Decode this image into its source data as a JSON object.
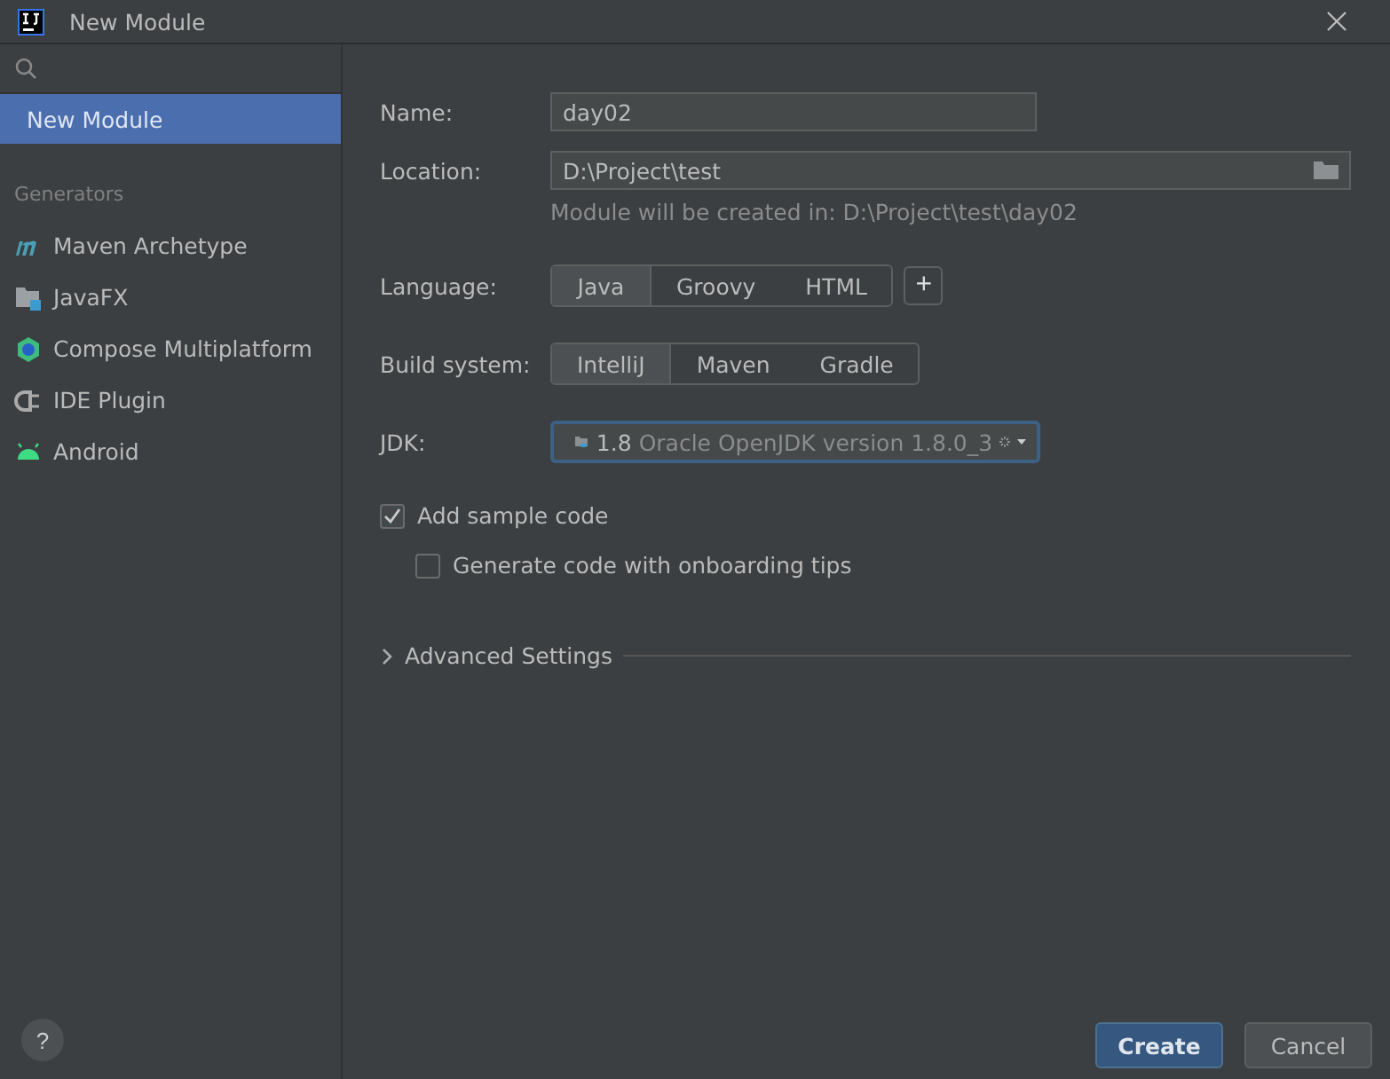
{
  "window": {
    "title": "New Module"
  },
  "help": "?",
  "sidebar": {
    "items": [
      {
        "label": "New Module",
        "selected": true
      }
    ],
    "section": "Generators",
    "generators": [
      {
        "label": "Maven Archetype",
        "kind": "maven",
        "selected": false
      },
      {
        "label": "JavaFX",
        "kind": "javafx",
        "selected": false
      },
      {
        "label": "Compose Multiplatform",
        "kind": "compose",
        "selected": false
      },
      {
        "label": "IDE Plugin",
        "kind": "plugin",
        "selected": false
      },
      {
        "label": "Android",
        "kind": "android",
        "selected": false
      }
    ]
  },
  "form": {
    "name": {
      "label": "Name:",
      "value": "day02"
    },
    "location": {
      "label": "Location:",
      "value": "D:\\Project\\test",
      "hint": "Module will be created in: D:\\Project\\test\\day02"
    },
    "language": {
      "label": "Language:",
      "options": [
        {
          "label": "Java",
          "selected": true
        },
        {
          "label": "Groovy",
          "selected": false
        },
        {
          "label": "HTML",
          "selected": false
        }
      ],
      "add": "+"
    },
    "build_system": {
      "label": "Build system:",
      "options": [
        {
          "label": "IntelliJ",
          "selected": true
        },
        {
          "label": "Maven",
          "selected": false
        },
        {
          "label": "Gradle",
          "selected": false
        }
      ]
    },
    "jdk": {
      "label": "JDK:",
      "version": "1.8",
      "detail": "Oracle OpenJDK version 1.8.0_3"
    },
    "checkboxes": [
      {
        "label": "Add sample code",
        "checked": true,
        "nested": false
      },
      {
        "label": "Generate code with onboarding tips",
        "checked": false,
        "nested": true
      }
    ],
    "advanced": {
      "label": "Advanced Settings",
      "expanded": false
    }
  },
  "buttons": [
    {
      "label": "Create",
      "kind": "primary"
    },
    {
      "label": "Cancel",
      "kind": "secondary"
    }
  ]
}
